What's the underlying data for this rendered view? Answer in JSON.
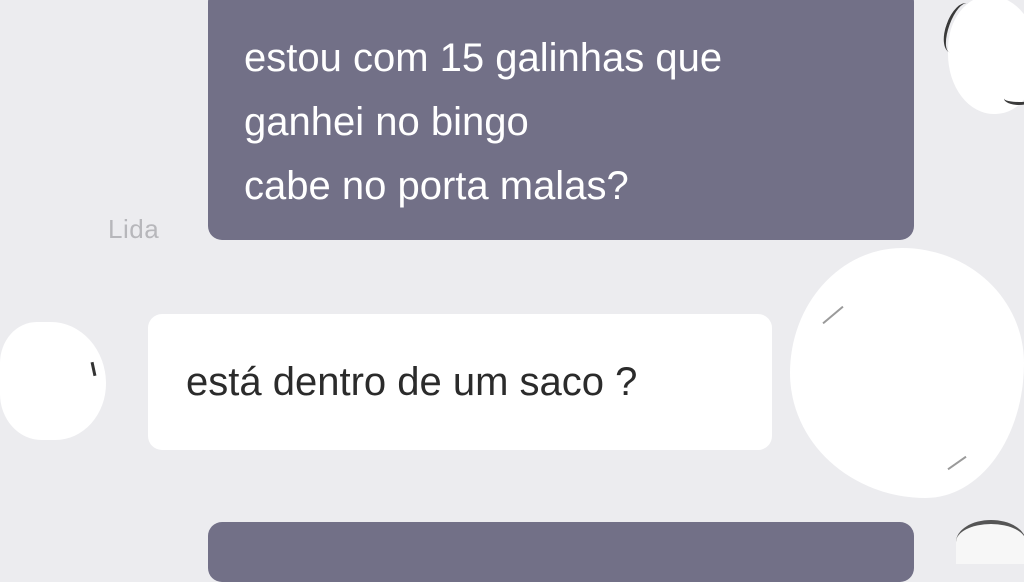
{
  "conversation": {
    "sender_name": "Lida",
    "outgoing_message": {
      "lines": [
        "estou com 15 galinhas que",
        "ganhei no bingo",
        "cabe no porta malas?"
      ]
    },
    "incoming_message": {
      "text": "está dentro de um saco ?"
    }
  },
  "colors": {
    "background": "#ececef",
    "outgoing_bubble": "#727087",
    "incoming_bubble": "#ffffff",
    "sender_label": "#b7b7bb"
  }
}
